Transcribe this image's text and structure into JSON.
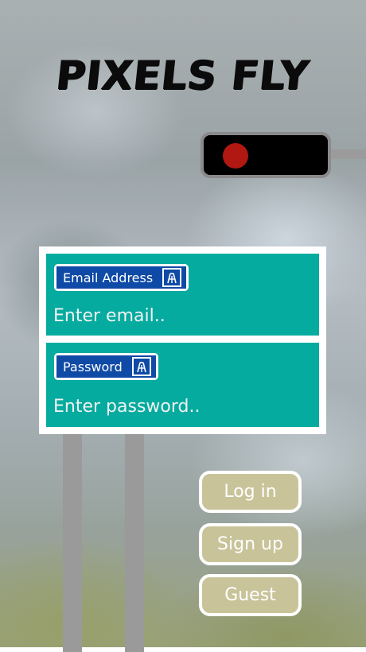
{
  "app": {
    "title": "PIXELS FLY"
  },
  "form": {
    "email": {
      "label": "Email Address",
      "placeholder": "Enter email..",
      "value": "",
      "icon": "motorway-icon"
    },
    "password": {
      "label": "Password",
      "placeholder": "Enter password..",
      "value": "",
      "icon": "motorway-icon"
    }
  },
  "buttons": {
    "login": "Log in",
    "signup": "Sign up",
    "guest": "Guest"
  },
  "signal": {
    "state": "red",
    "light_color": "#b11812"
  },
  "colors": {
    "panel": "#05ab9f",
    "label_bg": "#0f4aa6",
    "button_bg": "#c9c39a"
  }
}
